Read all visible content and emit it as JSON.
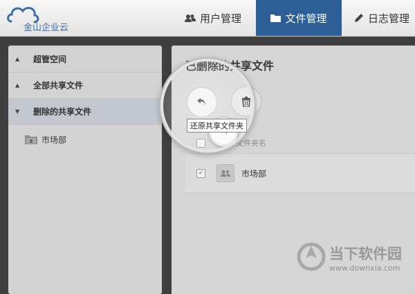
{
  "app": {
    "logo_text": "金山企业云"
  },
  "nav": {
    "users": "用户管理",
    "files": "文件管理",
    "logs": "日志管理"
  },
  "sidebar": {
    "items": [
      {
        "label": "超管空间",
        "arrow": "▲"
      },
      {
        "label": "全部共享文件",
        "arrow": "▲"
      },
      {
        "label": "删除的共享文件",
        "arrow": "▼"
      }
    ],
    "sub_item": "市场部"
  },
  "main": {
    "title": "已删除的共享文件",
    "tooltip": "还原共享文件夹",
    "column_header": "共享文件夹名",
    "rows": [
      {
        "name": "市场部",
        "checked": true
      }
    ]
  },
  "colors": {
    "nav_active": "#2d5e96",
    "logo_blue": "#3a6fa8",
    "sidebar_active": "#c2c7d0"
  },
  "icons": {
    "nav_users": "users-icon",
    "nav_files": "folder-icon",
    "nav_logs": "pencil-icon",
    "restore": "undo-arrow-icon",
    "delete": "trash-icon"
  },
  "watermark": {
    "title": "当下软件园",
    "url": "www.downxia.com"
  }
}
